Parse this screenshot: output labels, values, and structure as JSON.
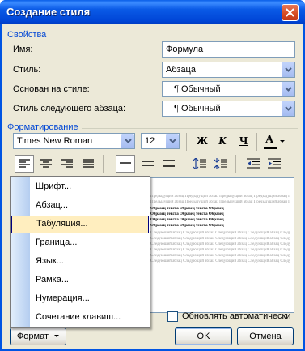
{
  "window": {
    "title": "Создание стиля"
  },
  "properties": {
    "group_label": "Свойства",
    "name_label": "Имя:",
    "name_value": "Формула",
    "style_label": "Стиль:",
    "style_value": "Абзаца",
    "based_on_label": "Основан на стиле:",
    "based_on_value": "¶ Обычный",
    "next_style_label": "Стиль следующего абзаца:",
    "next_style_value": "¶ Обычный"
  },
  "formatting": {
    "group_label": "Форматирование",
    "font_value": "Times New Roman",
    "size_value": "12",
    "bold": "Ж",
    "italic": "К",
    "underline": "Ч",
    "font_color_letter": "А"
  },
  "preview": {
    "before_text": "Предыдущий абзац Предыдущий абзац Предыдущий абзац Предыдущий абзац Предыдущий абзац Предыдущий абзац",
    "sample_lines": [
      "Образец текста Образец текста Образец",
      "Образец текста Образец текста Образец",
      "Образец текста Образец текста Образец",
      "Образец текста Образец текста Образец"
    ],
    "after_text": "Следующий абзац Следующий абзац Следующий абзац Следующий абзац Следующий абзац"
  },
  "menu": {
    "items": [
      "Шрифт...",
      "Абзац...",
      "Табуляция...",
      "Граница...",
      "Язык...",
      "Рамка...",
      "Нумерация...",
      "Сочетание клавиш..."
    ],
    "highlighted_index": 2
  },
  "footer": {
    "auto_update_label": "Обновлять автоматически",
    "format_button": "Формат",
    "ok_button": "OK",
    "cancel_button": "Отмена"
  },
  "colors": {
    "title_bar": "#0054e3",
    "dialog_bg": "#ece9d8",
    "group_label": "#0046d5",
    "font_color_bar": "#000000",
    "menu_highlight": "#ffeebf"
  }
}
